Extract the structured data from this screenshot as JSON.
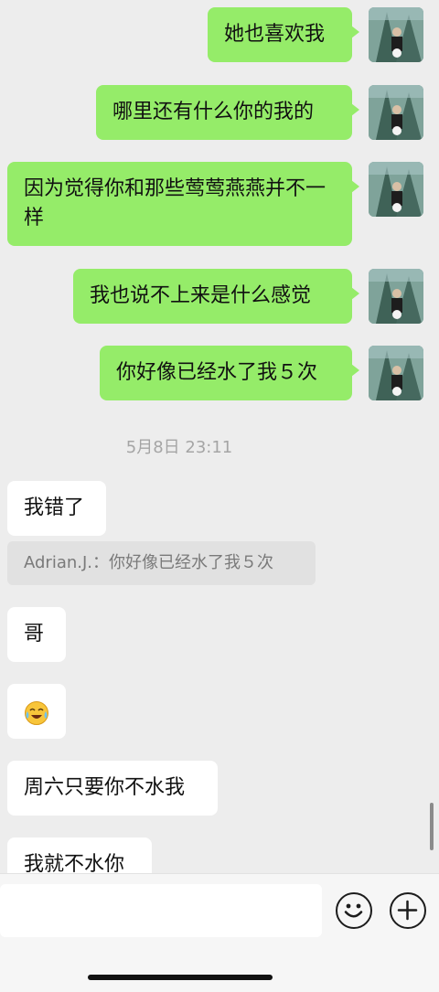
{
  "messages_out": [
    {
      "text": "她也喜欢我"
    },
    {
      "text": "哪里还有什么你的我的"
    },
    {
      "text": "因为觉得你和那些莺莺燕燕并不一样"
    },
    {
      "text": "我也说不上来是什么感觉"
    },
    {
      "text": "你好像已经水了我５次"
    }
  ],
  "timestamp": "5月8日 23:11",
  "messages_in": [
    {
      "text": "我错了"
    },
    {
      "text": "哥"
    },
    {
      "text": "周六只要你不水我"
    },
    {
      "text": "我就不水你"
    }
  ],
  "quote": {
    "text": "Adrian.J.：你好像已经水了我５次"
  },
  "emoji_message": {
    "icon": "crying-laughing-emoji-icon"
  },
  "input_bar": {
    "emoji_button_icon": "smiley-icon",
    "more_button_icon": "plus-circle-icon"
  },
  "colors": {
    "outgoing_bubble": "#95ec69",
    "incoming_bubble": "#ffffff",
    "background": "#ededed"
  }
}
